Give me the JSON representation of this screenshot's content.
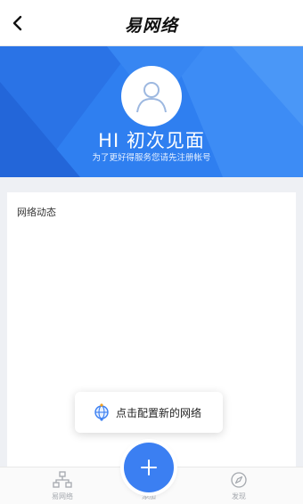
{
  "header": {
    "title": "易网络",
    "back_icon": "chevron-left-icon"
  },
  "hero": {
    "greeting": "HI 初次见面",
    "subtitle": "为了更好得服务您请先注册帐号",
    "avatar_icon": "user-avatar-icon",
    "background_color": "#2f7ff0"
  },
  "card": {
    "title": "网络动态"
  },
  "hint": {
    "icon": "globe-icon",
    "text": "点击配置新的网络"
  },
  "tabbar": {
    "items": [
      {
        "label": "易网络",
        "icon": "network-icon"
      },
      {
        "label": "添加",
        "icon": "plus-icon"
      },
      {
        "label": "发现",
        "icon": "compass-icon"
      }
    ],
    "accent_color": "#3b7ff2"
  }
}
